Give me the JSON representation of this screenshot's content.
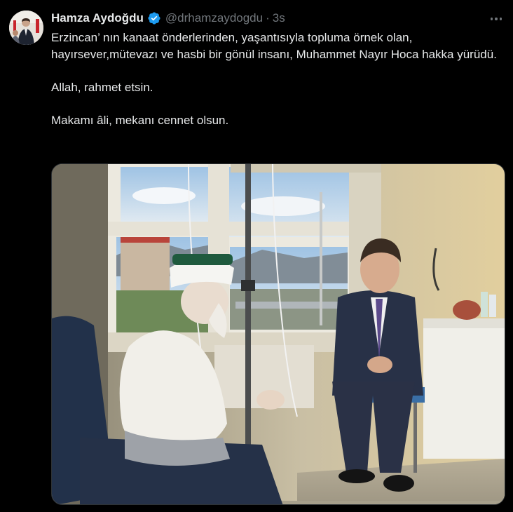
{
  "author": {
    "display_name": "Hamza Aydoğdu",
    "handle": "@drhamzaydogdu",
    "separator": "·",
    "time": "3s",
    "verified": true,
    "verified_color": "#1d9bf0"
  },
  "tweet": {
    "paragraphs": [
      "Erzincan’ nın kanaat önderlerinden, yaşantısıyla topluma örnek olan, hayırsever,mütevazı ve  hasbi bir gönül insanı, Muhammet Nayır Hoca hakka yürüdü.",
      "Allah, rahmet etsin.",
      "Makamı âli, mekanı cennet olsun."
    ]
  },
  "icons": {
    "more": "more-horizontal-icon",
    "verified": "verified-badge-icon"
  },
  "colors": {
    "background": "#000000",
    "text_primary": "#e7e9ea",
    "text_secondary": "#71767b",
    "accent": "#1d9bf0"
  }
}
